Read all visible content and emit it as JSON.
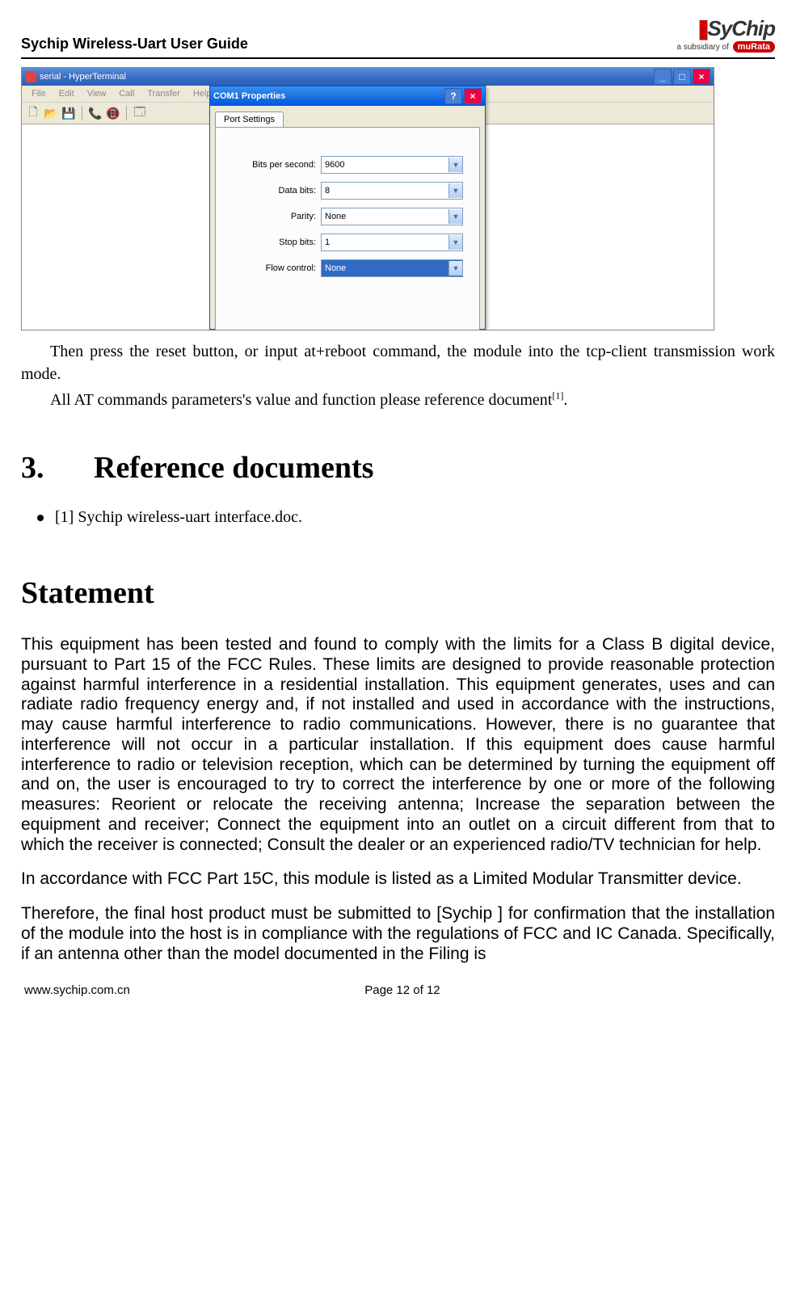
{
  "header": {
    "title": "Sychip Wireless-Uart User Guide",
    "logo_main": "SyChip",
    "logo_sub_prefix": "a subsidiary of",
    "logo_brand": "muRata"
  },
  "screenshot": {
    "main_window": {
      "title": "serial - HyperTerminal",
      "menus": [
        "File",
        "Edit",
        "View",
        "Call",
        "Transfer",
        "Help"
      ]
    },
    "dialog": {
      "title": "COM1 Properties",
      "tab": "Port Settings",
      "rows": [
        {
          "label": "Bits per second:",
          "value": "9600",
          "selected": false
        },
        {
          "label": "Data bits:",
          "value": "8",
          "selected": false
        },
        {
          "label": "Parity:",
          "value": "None",
          "selected": false
        },
        {
          "label": "Stop bits:",
          "value": "1",
          "selected": false
        },
        {
          "label": "Flow control:",
          "value": "None",
          "selected": true
        }
      ]
    }
  },
  "after_img": {
    "p1": "Then press the reset button, or input at+reboot command, the module into the tcp-client transmission work mode.",
    "p2_pre": "All AT commands parameters's value and function please reference document",
    "p2_sup": "[1]",
    "p2_post": "."
  },
  "section3": {
    "num": "3.",
    "title": "Reference documents",
    "item": "[1] Sychip wireless-uart interface.doc."
  },
  "statement": {
    "title": "Statement",
    "p1": "This equipment has been tested and found to comply with the limits for a Class B digital device, pursuant to Part 15 of the FCC Rules. These limits are designed to provide reasonable protection against harmful interference in a residential installation. This equipment generates, uses and can radiate radio frequency energy and, if not installed and used in accordance with the instructions, may cause harmful interference to radio communications. However, there is no guarantee that interference will not occur in a particular installation. If this equipment does cause harmful interference to radio or television reception, which can be determined by turning the equipment off and on, the user is encouraged to try to correct the interference by one or more of the following measures: Reorient or relocate the receiving antenna; Increase the separation between the equipment and receiver; Connect the equipment into an outlet on a circuit different from that to which the receiver is connected; Consult the dealer or an experienced radio/TV technician for help.",
    "p2": "In accordance with FCC Part 15C, this module is listed as a Limited Modular Transmitter device.",
    "p3": "Therefore, the final host product must be submitted to [Sychip ] for confirmation that the installation of the module into the host is in compliance with the regulations of FCC and IC Canada. Specifically, if an antenna other than the model documented in the Filing is"
  },
  "footer": {
    "left": "www.sychip.com.cn",
    "center": "Page 12 of 12"
  }
}
